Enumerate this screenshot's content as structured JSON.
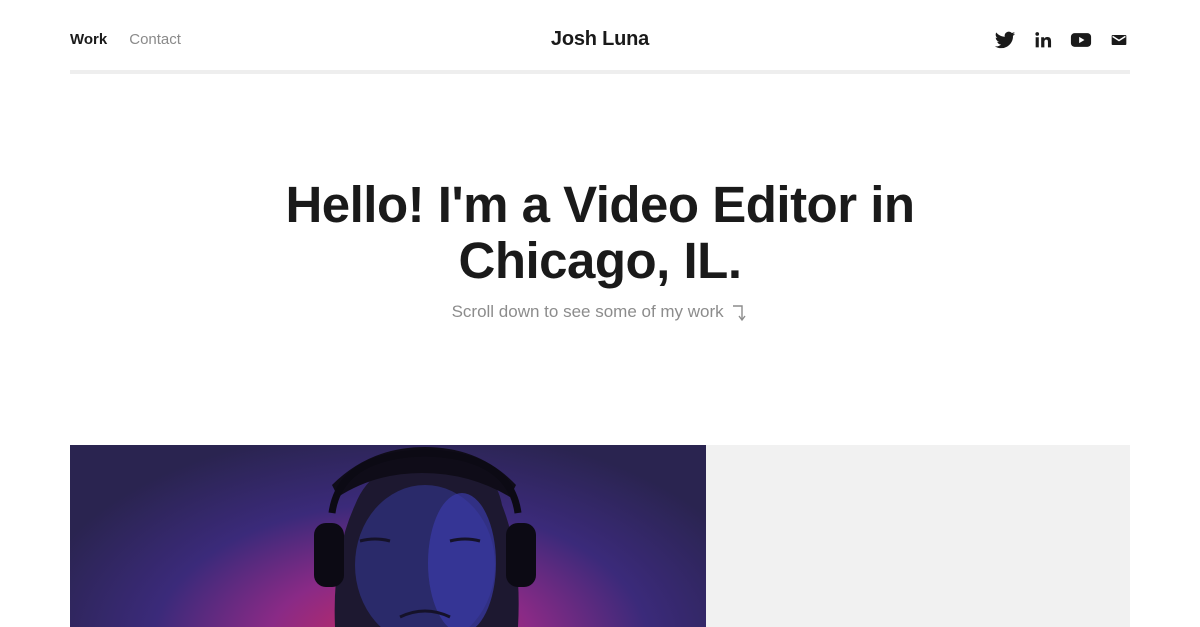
{
  "nav": {
    "work_label": "Work",
    "contact_label": "Contact"
  },
  "brand": {
    "name": "Josh Luna"
  },
  "social": {
    "icons": [
      "twitter-icon",
      "linkedin-icon",
      "youtube-icon",
      "mail-icon"
    ]
  },
  "hero": {
    "title": "Hello! I'm a Video Editor in Chicago, IL.",
    "subtitle": "Scroll down to see some of my work"
  },
  "colors": {
    "text": "#1a1a1a",
    "muted": "#8a8a8a",
    "divider": "#eeeeee",
    "placeholder": "#f1f1f1"
  }
}
